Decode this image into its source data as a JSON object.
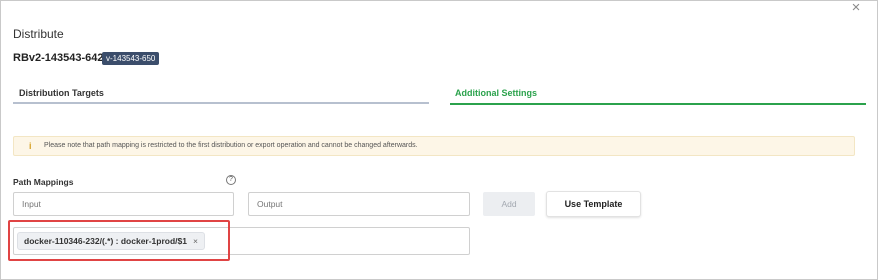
{
  "dialog": {
    "title": "Distribute",
    "close_glyph": "×",
    "close_icon": "close-icon"
  },
  "bundle": {
    "name": "RBv2-143543-642",
    "version": "v-143543-650"
  },
  "tabs": [
    {
      "label": "Distribution Targets",
      "active": false
    },
    {
      "label": "Additional Settings",
      "active": true
    }
  ],
  "notice": {
    "icon": "info-icon",
    "icon_glyph": "i",
    "text": "Please note that path mapping is restricted to the first distribution or export operation and cannot be changed afterwards."
  },
  "path_mappings": {
    "label": "Path Mappings",
    "help_icon": "help-icon",
    "help_glyph": "?",
    "input_placeholder": "Input",
    "output_placeholder": "Output",
    "add_label": "Add",
    "template_label": "Use Template",
    "chip_text": "docker-110346-232/(.*) : docker-1prod/$1",
    "chip_remove_glyph": "×"
  },
  "colors": {
    "accent_green": "#2ba24c",
    "badge_bg": "#3b4d6b",
    "notice_bg": "#fdf6e7",
    "highlight_red": "#e04444"
  }
}
